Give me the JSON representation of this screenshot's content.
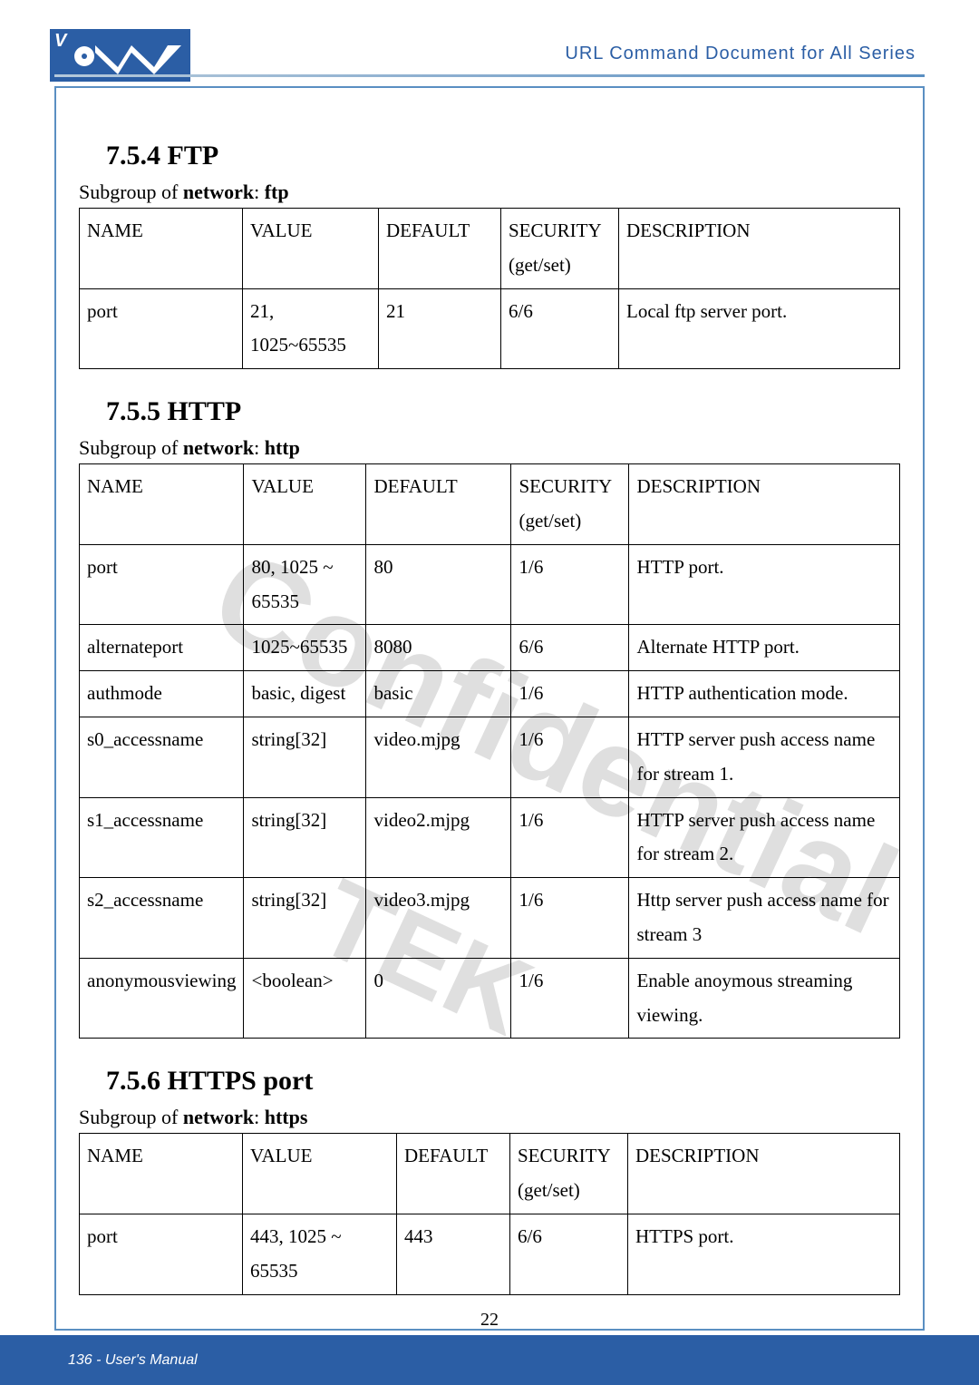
{
  "header": {
    "title": "URL Command Document for All Series"
  },
  "sections": {
    "ftp": {
      "heading": "7.5.4 FTP",
      "subgroup_prefix": "Subgroup of ",
      "subgroup_bold": "network",
      "subgroup_suffix": ": ",
      "subgroup_name": "ftp",
      "headers": {
        "name": "NAME",
        "value": "VALUE",
        "default": "DEFAULT",
        "security": "SECURITY (get/set)",
        "description": "DESCRIPTION"
      },
      "rows": [
        {
          "name": "port",
          "value": "21, 1025~65535",
          "default": "21",
          "security": "6/6",
          "description": "Local ftp server port."
        }
      ]
    },
    "http": {
      "heading": "7.5.5 HTTP",
      "subgroup_prefix": "Subgroup of ",
      "subgroup_bold": "network",
      "subgroup_suffix": ": ",
      "subgroup_name": "http",
      "headers": {
        "name": "NAME",
        "value": "VALUE",
        "default": "DEFAULT",
        "security": "SECURITY (get/set)",
        "description": "DESCRIPTION"
      },
      "rows": [
        {
          "name": "port",
          "value": "80, 1025 ~ 65535",
          "default": "80",
          "security": "1/6",
          "description": "HTTP port."
        },
        {
          "name": "alternateport",
          "value": "1025~65535",
          "default": "8080",
          "security": "6/6",
          "description": "Alternate HTTP port."
        },
        {
          "name": "authmode",
          "value": "basic, digest",
          "default": "basic",
          "security": "1/6",
          "description": "HTTP authentication mode."
        },
        {
          "name": "s0_accessname",
          "value": "string[32]",
          "default": "video.mjpg",
          "security": "1/6",
          "description": "HTTP server push access name for stream 1."
        },
        {
          "name": "s1_accessname",
          "value": "string[32]",
          "default": "video2.mjpg",
          "security": "1/6",
          "description": "HTTP server push access name for stream 2."
        },
        {
          "name": "s2_accessname",
          "value": "string[32]",
          "default": "video3.mjpg",
          "security": "1/6",
          "description": "Http server push access name for stream 3"
        },
        {
          "name": "anonymousviewing",
          "value": "<boolean>",
          "default": "0",
          "security": "1/6",
          "description": "Enable anoymous streaming viewing."
        }
      ]
    },
    "https": {
      "heading": "7.5.6 HTTPS port",
      "subgroup_prefix": "Subgroup of ",
      "subgroup_bold": "network",
      "subgroup_suffix": ": ",
      "subgroup_name": "https",
      "headers": {
        "name": "NAME",
        "value": "VALUE",
        "default": "DEFAULT",
        "security": "SECURITY (get/set)",
        "description": "DESCRIPTION"
      },
      "rows": [
        {
          "name": "port",
          "value": "443, 1025 ~ 65535",
          "default": "443",
          "security": "6/6",
          "description": "HTTPS port."
        }
      ]
    }
  },
  "footer": {
    "left": "136 - User's Manual",
    "center": "22"
  }
}
